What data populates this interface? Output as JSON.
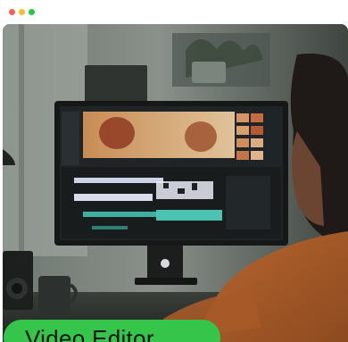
{
  "window": {
    "controls": [
      {
        "name": "close",
        "color": "#ff5f57"
      },
      {
        "name": "minimize",
        "color": "#febc2e"
      },
      {
        "name": "maximize",
        "color": "#28c840"
      }
    ]
  },
  "hero": {
    "image_subject": "video-editing-workstation-photo"
  },
  "badge": {
    "label": "Video Editor",
    "color": "#35c54b"
  }
}
